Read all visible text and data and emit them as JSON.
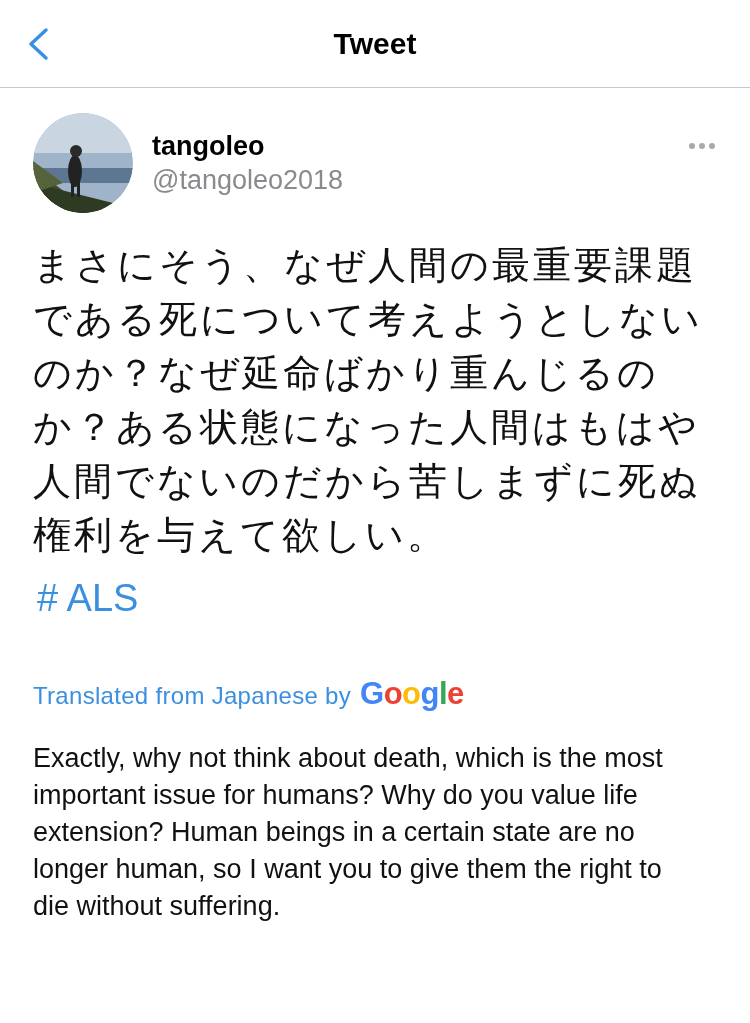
{
  "header": {
    "title": "Tweet"
  },
  "tweet": {
    "author": {
      "name": "tangoleo",
      "handle": "@tangoleo2018"
    },
    "text": "まさにそう、なぜ人間の最重要課題である死について考えようとしないのか？なぜ延命ばかり重んじるのか？ある状態になった人間はもはや人間でないのだから苦しまずに死ぬ権利を与えて欲しい。",
    "hashtag": "# ALS",
    "translation": {
      "label": "Translated from Japanese by",
      "provider": "Google",
      "text": "Exactly, why not think about death, which is the most important issue for humans? Why do you value life extension? Human beings in a certain state are no longer human, so I want you to give them the right to die without suffering."
    }
  }
}
